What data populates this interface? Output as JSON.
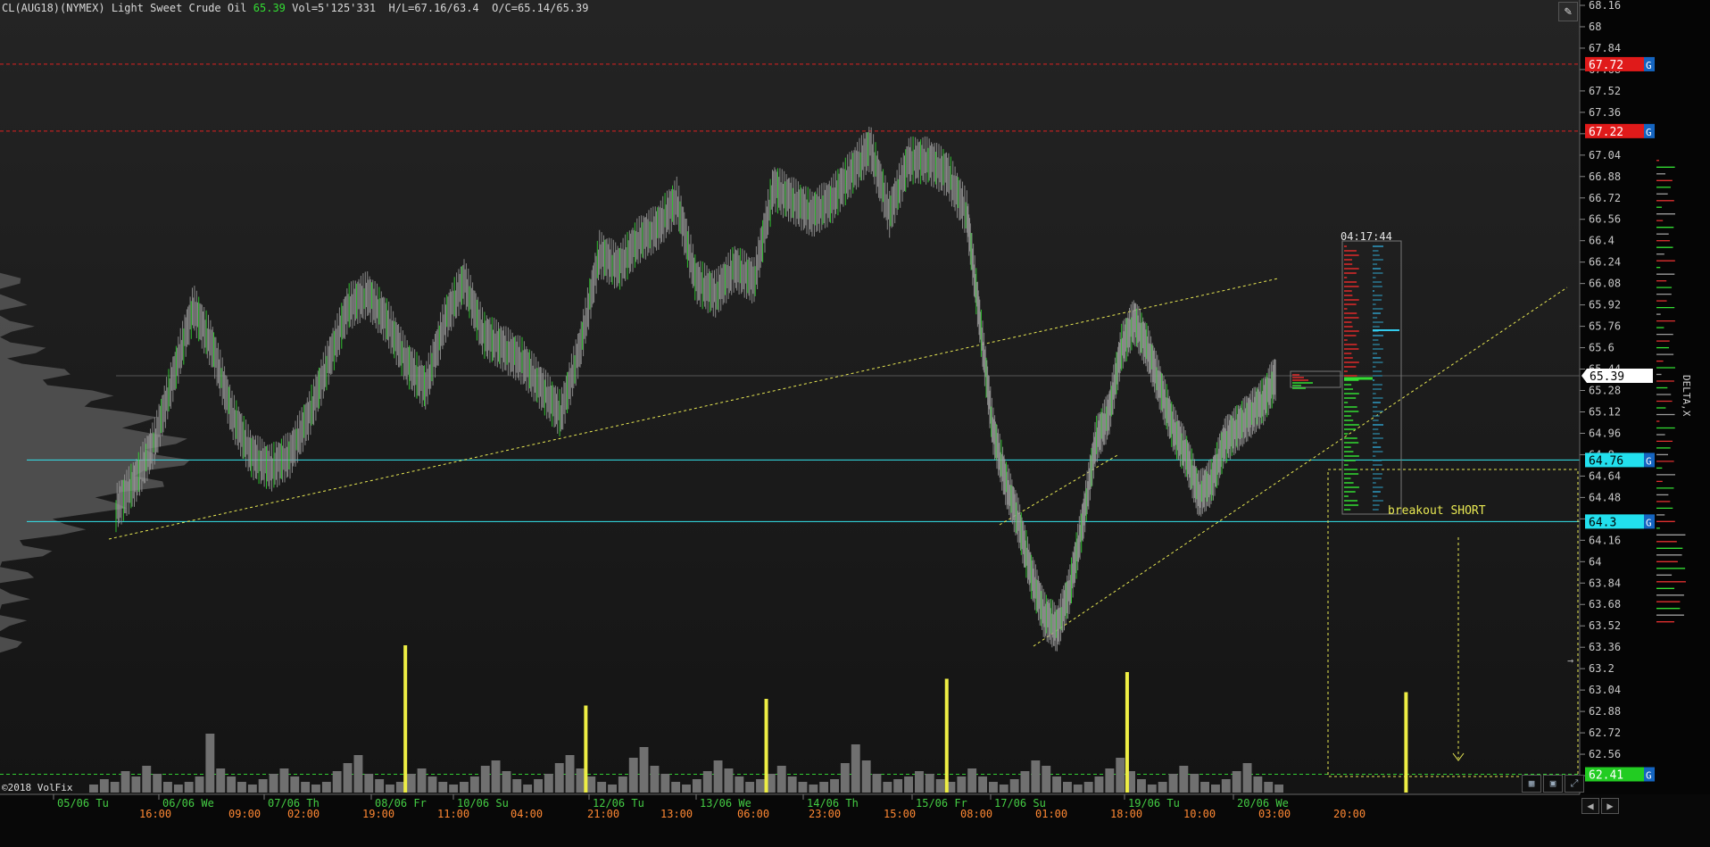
{
  "header": {
    "symbol": "CL(AUG18)(NYMEX) Light Sweet Crude Oil",
    "last": "65.39",
    "stats": "Vol=5'125'331  H/L=67.16/63.4  O/C=65.14/65.39"
  },
  "copyright": "©2018 VolFix",
  "countdown": "04:17:44",
  "annotation": "breakout SHORT",
  "side_label": "DELTA,X",
  "colors": {
    "background": "#000000",
    "panel": "#1b1b1b",
    "up": "#33dd33",
    "neutral": "#9a9a9a",
    "cyan": "#33e6ee",
    "red_level": "#e02020",
    "trend": "#e8e853",
    "volume": "#707070",
    "volume_spike": "#eeee44",
    "date_label": "#44cc44",
    "time_label": "#ff8833"
  },
  "icons": {
    "pencil": "pencil-icon",
    "nav_left": "chevron-left-icon",
    "nav_right": "chevron-right-icon"
  },
  "chart_data": {
    "type": "candlestick",
    "title": "CL(AUG18)(NYMEX) Light Sweet Crude Oil",
    "ylim": [
      62.3,
      68.2
    ],
    "price_ticks": [
      "68.16",
      "68",
      "67.84",
      "67.68",
      "67.52",
      "67.36",
      "67.2",
      "67.04",
      "66.88",
      "66.72",
      "66.56",
      "66.4",
      "66.24",
      "66.08",
      "65.92",
      "65.76",
      "65.6",
      "65.44",
      "65.28",
      "65.12",
      "64.96",
      "64.8",
      "64.64",
      "64.48",
      "64.32",
      "64.16",
      "64",
      "63.84",
      "63.68",
      "63.52",
      "63.36",
      "63.2",
      "63.04",
      "62.88",
      "62.72",
      "62.56",
      "62.4"
    ],
    "date_labels": [
      "05/06 Tu",
      "06/06 We",
      "07/06 Th",
      "08/06 Fr",
      "10/06 Su",
      "12/06 Tu",
      "13/06 We",
      "14/06 Th",
      "15/06 Fr",
      "17/06 Su",
      "19/06 Tu",
      "20/06 We"
    ],
    "time_labels": [
      "16:00",
      "09:00",
      "02:00",
      "19:00",
      "11:00",
      "04:00",
      "21:00",
      "13:00",
      "06:00",
      "23:00",
      "15:00",
      "08:00",
      "01:00",
      "18:00",
      "10:00",
      "03:00",
      "20:00"
    ],
    "price_series": [
      [
        0,
        64.4
      ],
      [
        3,
        64.6
      ],
      [
        6,
        64.9
      ],
      [
        9,
        65.4
      ],
      [
        12,
        65.9
      ],
      [
        15,
        65.6
      ],
      [
        18,
        65.1
      ],
      [
        21,
        64.8
      ],
      [
        24,
        64.7
      ],
      [
        27,
        64.8
      ],
      [
        30,
        65.1
      ],
      [
        33,
        65.5
      ],
      [
        36,
        65.9
      ],
      [
        39,
        66.0
      ],
      [
        42,
        65.8
      ],
      [
        45,
        65.5
      ],
      [
        48,
        65.3
      ],
      [
        51,
        65.8
      ],
      [
        54,
        66.1
      ],
      [
        57,
        65.7
      ],
      [
        60,
        65.6
      ],
      [
        63,
        65.5
      ],
      [
        66,
        65.3
      ],
      [
        69,
        65.1
      ],
      [
        72,
        65.6
      ],
      [
        75,
        66.3
      ],
      [
        78,
        66.2
      ],
      [
        81,
        66.4
      ],
      [
        84,
        66.5
      ],
      [
        87,
        66.7
      ],
      [
        90,
        66.1
      ],
      [
        93,
        66.0
      ],
      [
        96,
        66.2
      ],
      [
        99,
        66.1
      ],
      [
        102,
        66.8
      ],
      [
        105,
        66.7
      ],
      [
        108,
        66.6
      ],
      [
        111,
        66.7
      ],
      [
        114,
        66.9
      ],
      [
        117,
        67.1
      ],
      [
        120,
        66.6
      ],
      [
        123,
        67.0
      ],
      [
        126,
        67.0
      ],
      [
        129,
        66.9
      ],
      [
        132,
        66.6
      ],
      [
        134,
        65.8
      ],
      [
        136,
        65.0
      ],
      [
        138,
        64.6
      ],
      [
        140,
        64.3
      ],
      [
        142,
        63.9
      ],
      [
        144,
        63.6
      ],
      [
        146,
        63.5
      ],
      [
        148,
        63.8
      ],
      [
        150,
        64.3
      ],
      [
        152,
        64.9
      ],
      [
        154,
        65.1
      ],
      [
        156,
        65.6
      ],
      [
        158,
        65.8
      ],
      [
        160,
        65.6
      ],
      [
        162,
        65.3
      ],
      [
        164,
        65.0
      ],
      [
        166,
        64.8
      ],
      [
        168,
        64.5
      ],
      [
        170,
        64.6
      ],
      [
        172,
        64.9
      ],
      [
        174,
        65.0
      ],
      [
        176,
        65.1
      ],
      [
        178,
        65.2
      ],
      [
        180,
        65.39
      ]
    ],
    "volume_series": [
      3,
      5,
      4,
      8,
      6,
      10,
      7,
      4,
      3,
      4,
      6,
      22,
      9,
      6,
      4,
      3,
      5,
      7,
      9,
      6,
      4,
      3,
      4,
      8,
      11,
      14,
      7,
      5,
      3,
      4,
      7,
      9,
      6,
      4,
      3,
      4,
      6,
      10,
      12,
      8,
      5,
      3,
      5,
      7,
      11,
      14,
      9,
      6,
      4,
      3,
      6,
      13,
      17,
      10,
      7,
      4,
      3,
      5,
      8,
      12,
      9,
      6,
      4,
      5,
      7,
      10,
      6,
      4,
      3,
      4,
      5,
      11,
      18,
      12,
      7,
      4,
      5,
      6,
      8,
      7,
      5,
      4,
      6,
      9,
      6,
      4,
      3,
      5,
      8,
      12,
      10,
      6,
      4,
      3,
      4,
      6,
      9,
      13,
      8,
      5,
      3,
      4,
      7,
      10,
      7,
      4,
      3,
      5,
      8,
      11,
      6,
      4,
      3
    ],
    "volume_spikes": [
      11,
      22,
      33,
      44,
      55,
      72
    ],
    "volume_spike_values": [
      22,
      13,
      14,
      17,
      18,
      15
    ],
    "levels": [
      {
        "price": 67.72,
        "label": "67.72",
        "color": "red",
        "style": "dashed"
      },
      {
        "price": 67.22,
        "label": "67.22",
        "color": "red",
        "style": "dashed"
      },
      {
        "price": 64.76,
        "label": "64.76",
        "color": "cyan",
        "style": "solid"
      },
      {
        "price": 64.3,
        "label": "64.3",
        "color": "cyan",
        "style": "solid"
      },
      {
        "price": 62.41,
        "label": "62.41",
        "color": "green",
        "style": "dashed"
      }
    ],
    "level_tag": "G",
    "current_price": {
      "price": 65.39,
      "label": "65.39"
    }
  }
}
